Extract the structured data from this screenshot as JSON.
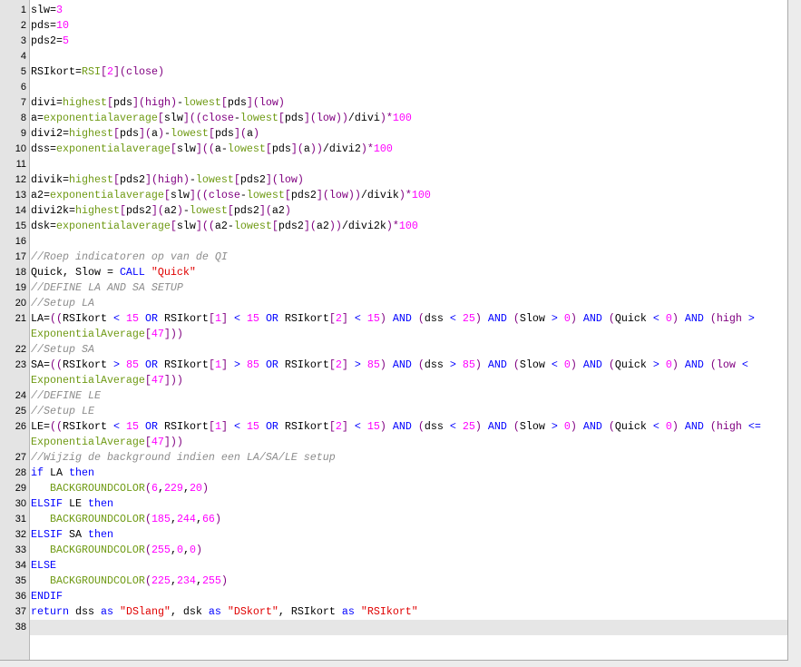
{
  "editor": {
    "current_line": 38,
    "lines": [
      {
        "n": "1",
        "code": "slw=3"
      },
      {
        "n": "2",
        "code": "pds=10"
      },
      {
        "n": "3",
        "code": "pds2=5"
      },
      {
        "n": "4",
        "code": ""
      },
      {
        "n": "5",
        "code": "RSIkort=RSI[2](close)"
      },
      {
        "n": "6",
        "code": ""
      },
      {
        "n": "7",
        "code": "divi=highest[pds](high)-lowest[pds](low)"
      },
      {
        "n": "8",
        "code": "a=exponentialaverage[slw]((close-lowest[pds](low))/divi)*100"
      },
      {
        "n": "9",
        "code": "divi2=highest[pds](a)-lowest[pds](a)"
      },
      {
        "n": "10",
        "code": "dss=exponentialaverage[slw]((a-lowest[pds](a))/divi2)*100"
      },
      {
        "n": "11",
        "code": ""
      },
      {
        "n": "12",
        "code": "divik=highest[pds2](high)-lowest[pds2](low)"
      },
      {
        "n": "13",
        "code": "a2=exponentialaverage[slw]((close-lowest[pds2](low))/divik)*100"
      },
      {
        "n": "14",
        "code": "divi2k=highest[pds2](a2)-lowest[pds2](a2)"
      },
      {
        "n": "15",
        "code": "dsk=exponentialaverage[slw]((a2-lowest[pds2](a2))/divi2k)*100"
      },
      {
        "n": "16",
        "code": ""
      },
      {
        "n": "17",
        "code": "//Roep indicatoren op van de QI"
      },
      {
        "n": "18",
        "code": "Quick, Slow = CALL \"Quick\""
      },
      {
        "n": "19",
        "code": "//DEFINE LA AND SA SETUP"
      },
      {
        "n": "20",
        "code": "//Setup LA"
      },
      {
        "n": "21",
        "code": "LA=((RSIkort < 15 OR RSIkort[1] < 15 OR RSIkort[2] < 15) AND (dss < 25) AND (Slow > 0) AND (Quick < 0) AND (high > ExponentialAverage[47]))"
      },
      {
        "n": "22",
        "code": "//Setup SA"
      },
      {
        "n": "23",
        "code": "SA=((RSIkort > 85 OR RSIkort[1] > 85 OR RSIkort[2] > 85) AND (dss > 85) AND (Slow < 0) AND (Quick > 0) AND (low < ExponentialAverage[47]))"
      },
      {
        "n": "24",
        "code": "//DEFINE LE"
      },
      {
        "n": "25",
        "code": "//Setup LE"
      },
      {
        "n": "26",
        "code": "LE=((RSIkort < 15 OR RSIkort[1] < 15 OR RSIkort[2] < 15) AND (dss < 25) AND (Slow > 0) AND (Quick < 0) AND (high <= ExponentialAverage[47]))"
      },
      {
        "n": "27",
        "code": "//Wijzig de background indien een LA/SA/LE setup"
      },
      {
        "n": "28",
        "code": "if LA then"
      },
      {
        "n": "29",
        "code": "   BACKGROUNDCOLOR(6,229,20)"
      },
      {
        "n": "30",
        "code": "ELSIF LE then"
      },
      {
        "n": "31",
        "code": "   BACKGROUNDCOLOR(185,244,66)"
      },
      {
        "n": "32",
        "code": "ELSIF SA then"
      },
      {
        "n": "33",
        "code": "   BACKGROUNDCOLOR(255,0,0)"
      },
      {
        "n": "34",
        "code": "ELSE"
      },
      {
        "n": "35",
        "code": "   BACKGROUNDCOLOR(225,234,255)"
      },
      {
        "n": "36",
        "code": "ENDIF"
      },
      {
        "n": "37",
        "code": "return dss as \"DSlang\", dsk as \"DSkort\", RSIkort as \"RSIkort\""
      },
      {
        "n": "38",
        "code": ""
      }
    ]
  },
  "colors": {
    "text": "#000000",
    "keyword": "#0000ff",
    "function": "#6f9a14",
    "number": "#ff00ff",
    "string": "#e00000",
    "constant": "#800080",
    "operator": "#0000ff",
    "bracket": "#800080",
    "comment": "#8c8c8c",
    "gutter": "#e4e4e4",
    "current_line": "#e6e6e6"
  }
}
